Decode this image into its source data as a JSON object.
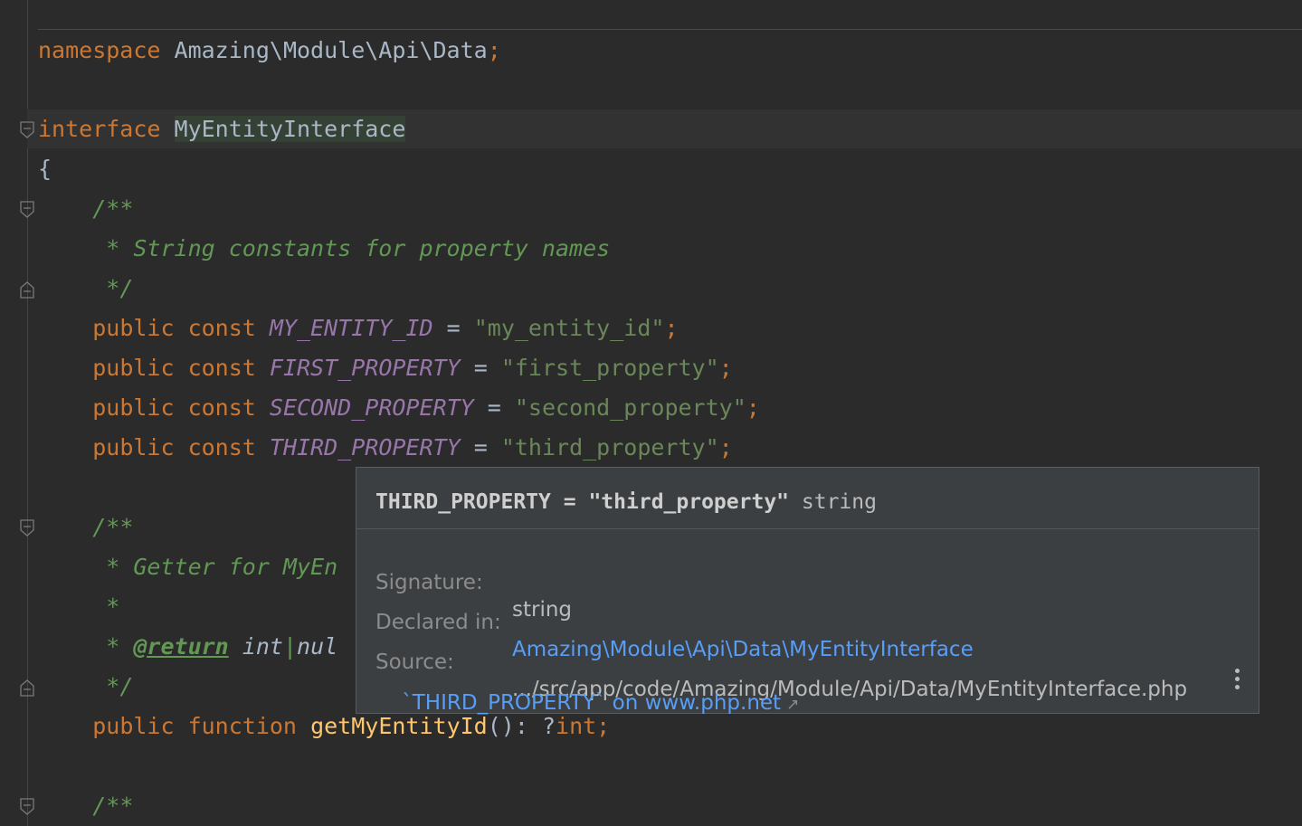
{
  "editor": {
    "lines": {
      "namespace": {
        "kw": "namespace",
        "name": "Amazing\\Module\\Api\\Data",
        "semi": ";"
      },
      "interface": {
        "kw": "interface",
        "name": "MyEntityInterface"
      },
      "open_brace": "{",
      "doc1_open": "/**",
      "doc1_text": " * String constants for property names",
      "doc1_close": " */",
      "consts": [
        {
          "mods": "public const",
          "name": "MY_ENTITY_ID",
          "eq": "=",
          "value": "\"my_entity_id\"",
          "semi": ";"
        },
        {
          "mods": "public const",
          "name": "FIRST_PROPERTY",
          "eq": "=",
          "value": "\"first_property\"",
          "semi": ";"
        },
        {
          "mods": "public const",
          "name": "SECOND_PROPERTY",
          "eq": "=",
          "value": "\"second_property\"",
          "semi": ";"
        },
        {
          "mods": "public const",
          "name": "THIRD_PROPERTY",
          "eq": "=",
          "value": "\"third_property\"",
          "semi": ";"
        }
      ],
      "doc2_open": "/**",
      "doc2_text": " * Getter for MyEn",
      "doc2_star": " *",
      "doc2_return_star": " * ",
      "doc2_return_tag": "@return",
      "doc2_return_type": "int",
      "doc2_return_pipe": "|",
      "doc2_return_rest": "nul",
      "doc2_close": " */",
      "func": {
        "mods": "public function",
        "name": "getMyEntityId",
        "parens": "():",
        "ret_q": "?",
        "ret_type": "int",
        "semi": ";"
      },
      "doc3_open": "/**"
    }
  },
  "popup": {
    "header_name": "THIRD_PROPERTY",
    "header_eq": "=",
    "header_value": "\"third_property\"",
    "header_type": "string",
    "signature_label": "Signature:",
    "signature_value": "string",
    "declared_label": "Declared in:",
    "declared_value": "Amazing\\Module\\Api\\Data\\MyEntityInterface",
    "source_label": "Source:",
    "source_value": ".../src/app/code/Amazing/Module/Api/Data/MyEntityInterface.php",
    "php_link": "`THIRD_PROPERTY` on www.php.net",
    "icons": {
      "external": "external-link-arrow-icon",
      "more": "vertical-ellipsis-icon"
    }
  },
  "colors": {
    "background": "#2b2b2b",
    "keyword": "#cc7832",
    "constant": "#9876aa",
    "string": "#6a8759",
    "comment": "#629755",
    "function": "#ffc66d",
    "link": "#589df6",
    "popup_bg": "#3c3f41"
  }
}
